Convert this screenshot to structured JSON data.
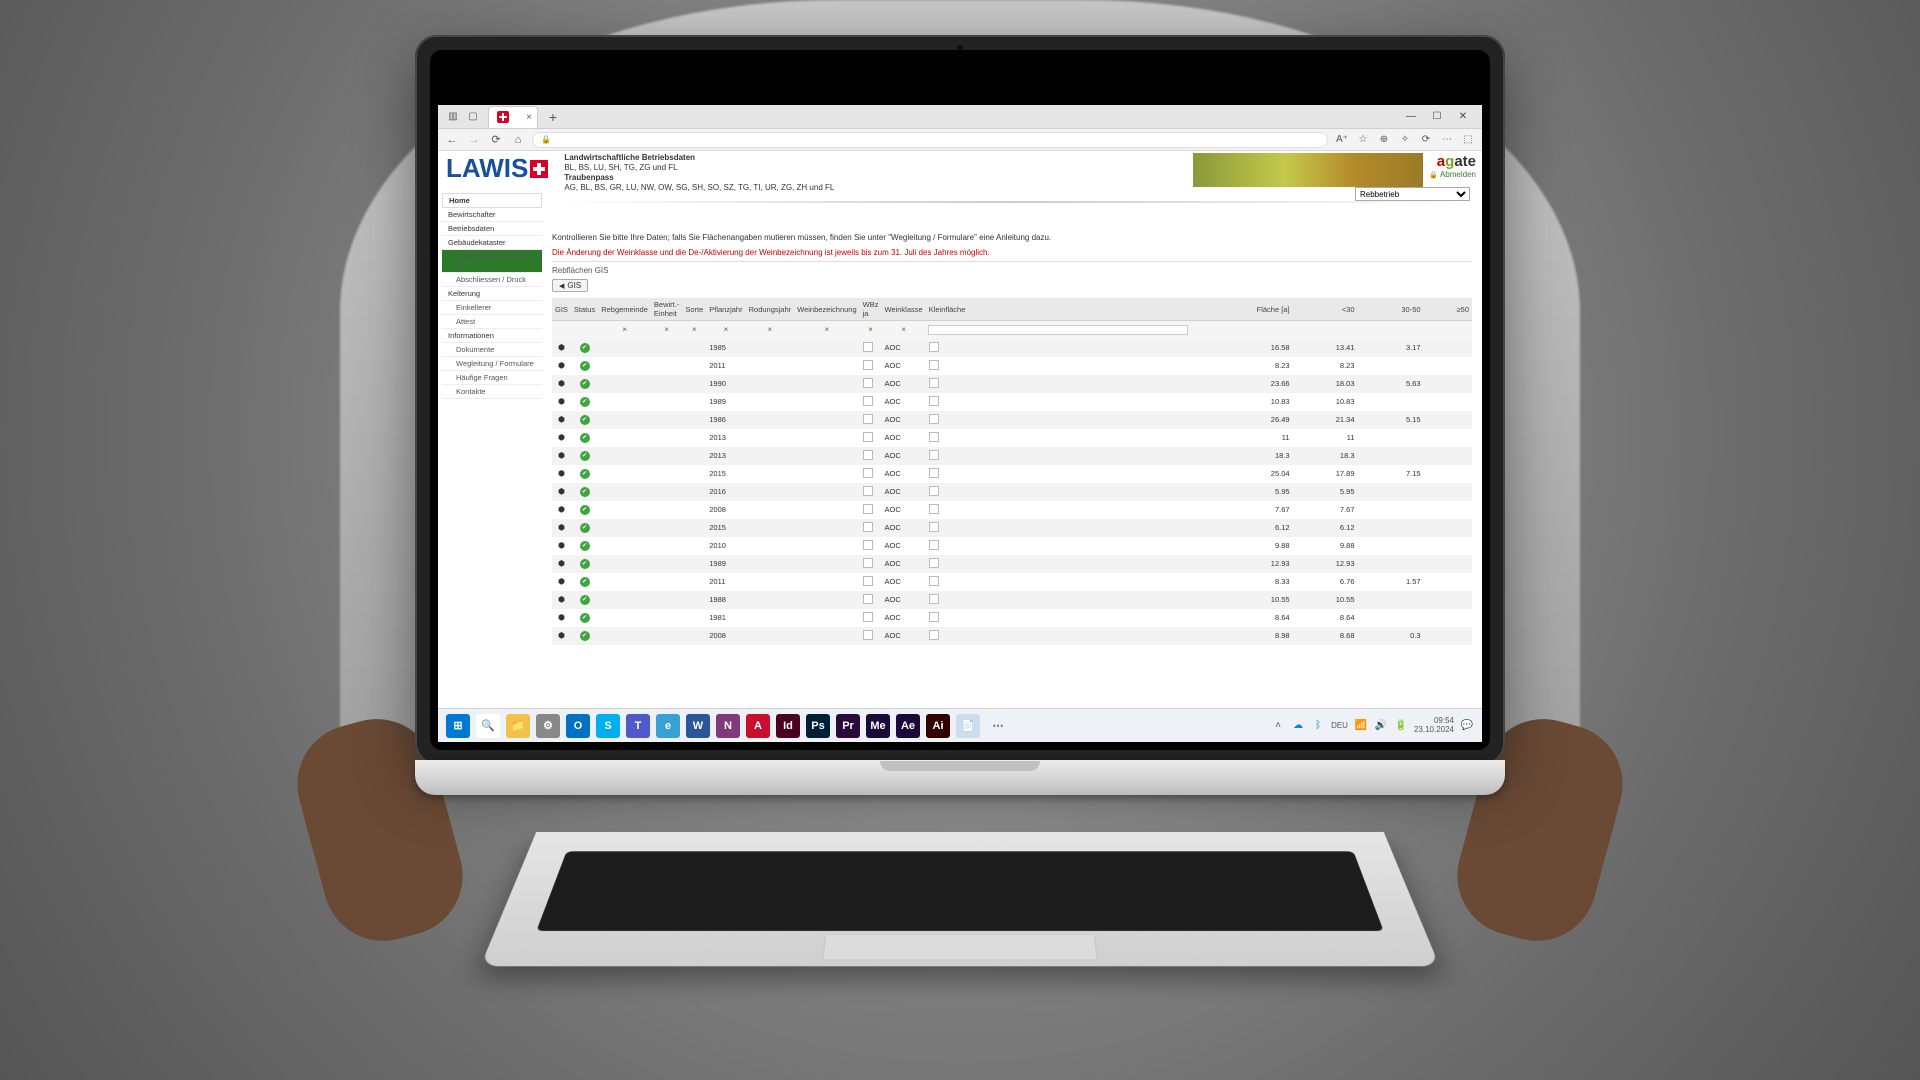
{
  "browser": {
    "tab_title": "",
    "window_min": "—",
    "window_max": "☐",
    "window_close": "✕",
    "tab_close": "×",
    "new_tab": "+",
    "addrbar_icons": {
      "back": "←",
      "fwd": "→",
      "reload": "⟳",
      "home": "⌂",
      "lock": "🔒"
    },
    "right_icons": [
      "A⁺",
      "☆",
      "⊕",
      "✧",
      "⟳",
      "⋯",
      "⬚"
    ]
  },
  "header": {
    "logo": "LAWIS",
    "title": "Landwirtschaftliche Betriebsdaten",
    "line1": "BL, BS, LU, SH, TG, ZG und FL",
    "line2": "Traubenpass",
    "line3": "AG, BL, BS, GR, LU, NW, OW, SG, SH, SO, SZ, TG, TI, UR, ZG, ZH und FL",
    "agate": {
      "a": "a",
      "g": "g",
      "rest": "ate",
      "logout": "Abmelden"
    },
    "dropdown": "Rebbetrieb"
  },
  "menu": {
    "home": "Home",
    "items": [
      {
        "label": "Bewirtschafter",
        "sel": false,
        "sub": false
      },
      {
        "label": "Betriebsdaten",
        "sel": false,
        "sub": false
      },
      {
        "label": "Gebäudekataster",
        "sel": false,
        "sub": false
      },
      {
        "label": "Rebflächenverzeichnis GIS",
        "sel": true,
        "sub": true
      },
      {
        "label": "Abschliessen / Druck",
        "sel": false,
        "sub": true
      },
      {
        "label": "Kelterung",
        "sel": false,
        "sub": false
      },
      {
        "label": "Einkellerer",
        "sel": false,
        "sub": true
      },
      {
        "label": "Attest",
        "sel": false,
        "sub": true
      },
      {
        "label": "Informationen",
        "sel": false,
        "sub": false
      },
      {
        "label": "Dokumente",
        "sel": false,
        "sub": true
      },
      {
        "label": "Wegleitung / Formulare",
        "sel": false,
        "sub": true
      },
      {
        "label": "Häufige Fragen",
        "sel": false,
        "sub": true
      },
      {
        "label": "Kontakte",
        "sel": false,
        "sub": true
      }
    ]
  },
  "main": {
    "hint": "Kontrollieren Sie bitte Ihre Daten; falls Sie Flächenangaben mutieren müssen, finden Sie unter \"Wegleitung / Formulare\" eine Anleitung dazu.",
    "notice": "Die Änderung der Weinklasse und die De-/Aktivierung der Weinbezeichnung ist jeweils bis zum 31. Juli des Jahres möglich.",
    "section": "Rebflächen GIS",
    "gis_btn": "GIS"
  },
  "table": {
    "columns": [
      "GIS",
      "Status",
      "Rebgemeinde",
      "Bewirt.-Einheit",
      "Sorte",
      "Pflanzjahr",
      "Rodungsjahr",
      "Weinbezeichnung",
      "WBz ja",
      "Weinklasse",
      "Kleinfläche",
      "Fläche [a]",
      "<30",
      "30-50",
      "≥50"
    ],
    "rows": [
      {
        "pflanzjahr": "1985",
        "weinklasse": "AOC",
        "flaeche": "16.58",
        "lt30": "13.41",
        "m30_50": "3.17",
        "ge50": ""
      },
      {
        "pflanzjahr": "2011",
        "weinklasse": "AOC",
        "flaeche": "8.23",
        "lt30": "8.23",
        "m30_50": "",
        "ge50": ""
      },
      {
        "pflanzjahr": "1990",
        "weinklasse": "AOC",
        "flaeche": "23.66",
        "lt30": "18.03",
        "m30_50": "5.63",
        "ge50": ""
      },
      {
        "pflanzjahr": "1989",
        "weinklasse": "AOC",
        "flaeche": "10.83",
        "lt30": "10.83",
        "m30_50": "",
        "ge50": ""
      },
      {
        "pflanzjahr": "1986",
        "weinklasse": "AOC",
        "flaeche": "26.49",
        "lt30": "21.34",
        "m30_50": "5.15",
        "ge50": ""
      },
      {
        "pflanzjahr": "2013",
        "weinklasse": "AOC",
        "flaeche": "11",
        "lt30": "11",
        "m30_50": "",
        "ge50": ""
      },
      {
        "pflanzjahr": "2013",
        "weinklasse": "AOC",
        "flaeche": "18.3",
        "lt30": "18.3",
        "m30_50": "",
        "ge50": ""
      },
      {
        "pflanzjahr": "2015",
        "weinklasse": "AOC",
        "flaeche": "25.04",
        "lt30": "17.89",
        "m30_50": "7.15",
        "ge50": ""
      },
      {
        "pflanzjahr": "2016",
        "weinklasse": "AOC",
        "flaeche": "5.95",
        "lt30": "5.95",
        "m30_50": "",
        "ge50": ""
      },
      {
        "pflanzjahr": "2008",
        "weinklasse": "AOC",
        "flaeche": "7.67",
        "lt30": "7.67",
        "m30_50": "",
        "ge50": ""
      },
      {
        "pflanzjahr": "2015",
        "weinklasse": "AOC",
        "flaeche": "6.12",
        "lt30": "6.12",
        "m30_50": "",
        "ge50": ""
      },
      {
        "pflanzjahr": "2010",
        "weinklasse": "AOC",
        "flaeche": "9.88",
        "lt30": "9.88",
        "m30_50": "",
        "ge50": ""
      },
      {
        "pflanzjahr": "1989",
        "weinklasse": "AOC",
        "flaeche": "12.93",
        "lt30": "12.93",
        "m30_50": "",
        "ge50": ""
      },
      {
        "pflanzjahr": "2011",
        "weinklasse": "AOC",
        "flaeche": "8.33",
        "lt30": "6.76",
        "m30_50": "1.57",
        "ge50": ""
      },
      {
        "pflanzjahr": "1988",
        "weinklasse": "AOC",
        "flaeche": "10.55",
        "lt30": "10.55",
        "m30_50": "",
        "ge50": ""
      },
      {
        "pflanzjahr": "1981",
        "weinklasse": "AOC",
        "flaeche": "8.64",
        "lt30": "8.64",
        "m30_50": "",
        "ge50": ""
      },
      {
        "pflanzjahr": "2008",
        "weinklasse": "AOC",
        "flaeche": "8.98",
        "lt30": "8.68",
        "m30_50": "0.3",
        "ge50": ""
      }
    ]
  },
  "taskbar": {
    "icons": [
      {
        "name": "start",
        "bg": "#0078d4",
        "txt": "⊞"
      },
      {
        "name": "search",
        "bg": "#fff",
        "txt": "🔍",
        "fg": "#333"
      },
      {
        "name": "explorer",
        "bg": "#f3c04b",
        "txt": "📁"
      },
      {
        "name": "settings",
        "bg": "#888",
        "txt": "⚙"
      },
      {
        "name": "outlook",
        "bg": "#0072c6",
        "txt": "O"
      },
      {
        "name": "skype",
        "bg": "#00aff0",
        "txt": "S"
      },
      {
        "name": "teams",
        "bg": "#5059c9",
        "txt": "T"
      },
      {
        "name": "edge",
        "bg": "#39a0d6",
        "txt": "e"
      },
      {
        "name": "word",
        "bg": "#2b579a",
        "txt": "W"
      },
      {
        "name": "onenote",
        "bg": "#80397b",
        "txt": "N"
      },
      {
        "name": "acrobat",
        "bg": "#c8102e",
        "txt": "A"
      },
      {
        "name": "indesign",
        "bg": "#49021f",
        "txt": "Id"
      },
      {
        "name": "photoshop",
        "bg": "#001e36",
        "txt": "Ps"
      },
      {
        "name": "premiere",
        "bg": "#2a0a3a",
        "txt": "Pr"
      },
      {
        "name": "media-encoder",
        "bg": "#1a0a3a",
        "txt": "Me"
      },
      {
        "name": "after-effects",
        "bg": "#1a0a3a",
        "txt": "Ae"
      },
      {
        "name": "illustrator",
        "bg": "#330000",
        "txt": "Ai"
      },
      {
        "name": "notes",
        "bg": "#cde",
        "txt": "📄",
        "fg": "#333"
      },
      {
        "name": "overflow",
        "bg": "transparent",
        "txt": "⋯",
        "fg": "#555"
      }
    ],
    "tray": {
      "chevron": "˄",
      "cloud": "☁",
      "bt": "ᛒ",
      "lang": "DEU",
      "wifi": "📶",
      "vol": "🔊",
      "bat": "🔋"
    },
    "time": "09:54",
    "date": "23.10.2024"
  }
}
